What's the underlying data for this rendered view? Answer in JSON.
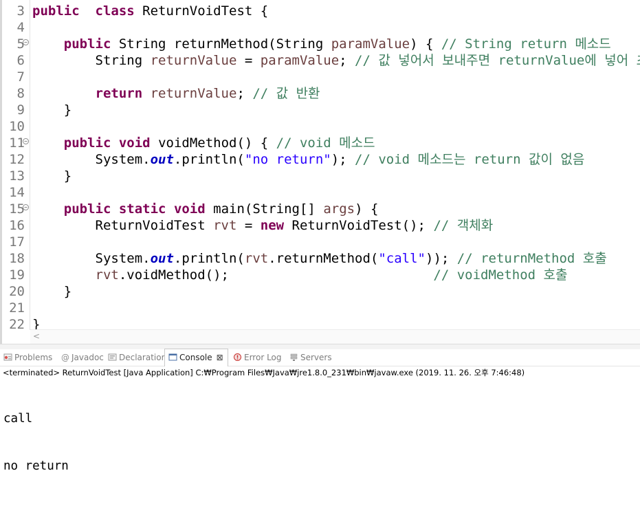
{
  "editor": {
    "lines": [
      {
        "n": "3",
        "fold": false,
        "tokens": [
          [
            "kw",
            "public"
          ],
          [
            "",
            "  "
          ],
          [
            "kw",
            "class"
          ],
          [
            "",
            " ReturnVoidTest {"
          ]
        ]
      },
      {
        "n": "4",
        "fold": false,
        "tokens": []
      },
      {
        "n": "5",
        "fold": true,
        "tokens": [
          [
            "",
            "    "
          ],
          [
            "kw",
            "public"
          ],
          [
            "",
            " String returnMethod(String "
          ],
          [
            "var",
            "paramValue"
          ],
          [
            "",
            ") { "
          ],
          [
            "cm",
            "// String return 메소드"
          ]
        ]
      },
      {
        "n": "6",
        "fold": false,
        "tokens": [
          [
            "",
            "        String "
          ],
          [
            "var",
            "returnValue"
          ],
          [
            "",
            " = "
          ],
          [
            "var",
            "paramValue"
          ],
          [
            "",
            "; "
          ],
          [
            "cm",
            "// 값 넣어서 보내주면 returnValue에 넣어 초기화"
          ]
        ]
      },
      {
        "n": "7",
        "fold": false,
        "tokens": []
      },
      {
        "n": "8",
        "fold": false,
        "tokens": [
          [
            "",
            "        "
          ],
          [
            "kw",
            "return"
          ],
          [
            "",
            " "
          ],
          [
            "var",
            "returnValue"
          ],
          [
            "",
            "; "
          ],
          [
            "cm",
            "// 값 반환"
          ]
        ]
      },
      {
        "n": "9",
        "fold": false,
        "tokens": [
          [
            "",
            "    }"
          ]
        ]
      },
      {
        "n": "10",
        "fold": false,
        "tokens": []
      },
      {
        "n": "11",
        "fold": true,
        "tokens": [
          [
            "",
            "    "
          ],
          [
            "kw",
            "public"
          ],
          [
            "",
            " "
          ],
          [
            "kw",
            "void"
          ],
          [
            "",
            " voidMethod() { "
          ],
          [
            "cm",
            "// void 메소드"
          ]
        ]
      },
      {
        "n": "12",
        "fold": false,
        "tokens": [
          [
            "",
            "        System."
          ],
          [
            "fld",
            "out"
          ],
          [
            "",
            ".println("
          ],
          [
            "str",
            "\"no return\""
          ],
          [
            "",
            "); "
          ],
          [
            "cm",
            "// void 메소드는 return 값이 없음"
          ]
        ]
      },
      {
        "n": "13",
        "fold": false,
        "tokens": [
          [
            "",
            "    }"
          ]
        ]
      },
      {
        "n": "14",
        "fold": false,
        "tokens": []
      },
      {
        "n": "15",
        "fold": true,
        "tokens": [
          [
            "",
            "    "
          ],
          [
            "kw",
            "public"
          ],
          [
            "",
            " "
          ],
          [
            "kw",
            "static"
          ],
          [
            "",
            " "
          ],
          [
            "kw",
            "void"
          ],
          [
            "",
            " main(String[] "
          ],
          [
            "var",
            "args"
          ],
          [
            "",
            ") {"
          ]
        ]
      },
      {
        "n": "16",
        "fold": false,
        "tokens": [
          [
            "",
            "        ReturnVoidTest "
          ],
          [
            "var",
            "rvt"
          ],
          [
            "",
            " = "
          ],
          [
            "kw",
            "new"
          ],
          [
            "",
            " ReturnVoidTest(); "
          ],
          [
            "cm",
            "// 객체화"
          ]
        ]
      },
      {
        "n": "17",
        "fold": false,
        "tokens": []
      },
      {
        "n": "18",
        "fold": false,
        "tokens": [
          [
            "",
            "        System."
          ],
          [
            "fld",
            "out"
          ],
          [
            "",
            ".println("
          ],
          [
            "var",
            "rvt"
          ],
          [
            "",
            ".returnMethod("
          ],
          [
            "str",
            "\"call\""
          ],
          [
            "",
            ")); "
          ],
          [
            "cm",
            "// returnMethod 호출"
          ]
        ]
      },
      {
        "n": "19",
        "fold": false,
        "tokens": [
          [
            "",
            "        "
          ],
          [
            "var",
            "rvt"
          ],
          [
            "",
            ".voidMethod();                          "
          ],
          [
            "cm",
            "// voidMethod 호출"
          ]
        ]
      },
      {
        "n": "20",
        "fold": false,
        "tokens": [
          [
            "",
            "    }"
          ]
        ]
      },
      {
        "n": "21",
        "fold": false,
        "tokens": []
      },
      {
        "n": "22",
        "fold": false,
        "tokens": [
          [
            "",
            "}"
          ]
        ]
      }
    ],
    "scroll_left_glyph": "<"
  },
  "panel": {
    "tabs": [
      {
        "label": "Problems",
        "icon": "problems-icon",
        "active": false
      },
      {
        "label": "Javadoc",
        "icon": "javadoc-icon",
        "active": false
      },
      {
        "label": "Declaration",
        "icon": "declaration-icon",
        "active": false
      },
      {
        "label": "Console",
        "icon": "console-icon",
        "active": true
      },
      {
        "label": "Error Log",
        "icon": "error-log-icon",
        "active": false
      },
      {
        "label": "Servers",
        "icon": "servers-icon",
        "active": false
      }
    ],
    "close_glyph": "⊠",
    "status": "<terminated> ReturnVoidTest [Java Application] C:₩Program Files₩Java₩jre1.8.0_231₩bin₩javaw.exe (2019. 11. 26. 오후 7:46:48)",
    "output": [
      "call",
      "no return"
    ]
  }
}
